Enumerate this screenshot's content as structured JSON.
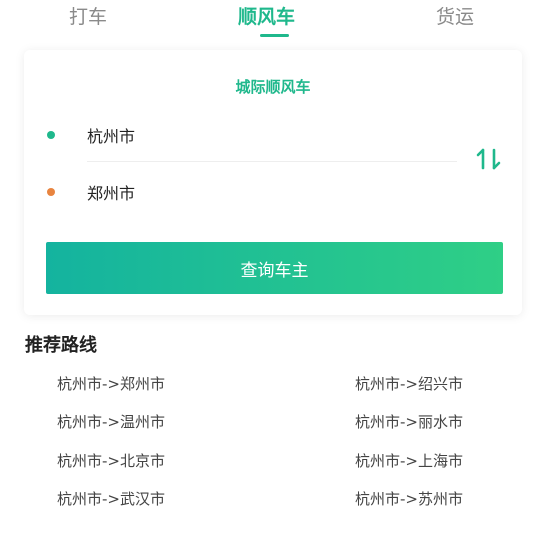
{
  "tabs": [
    {
      "label": "打车"
    },
    {
      "label": "顺风车"
    },
    {
      "label": "货运"
    }
  ],
  "card": {
    "title": "城际顺风车",
    "from_city": "杭州市",
    "to_city": "郑州市",
    "query_button": "查询车主"
  },
  "recommend": {
    "title": "推荐路线",
    "left": [
      "杭州市->郑州市",
      "杭州市->温州市",
      "杭州市->北京市",
      "杭州市->武汉市"
    ],
    "right": [
      "杭州市->绍兴市",
      "杭州市->丽水市",
      "杭州市->上海市",
      "杭州市->苏州市"
    ]
  },
  "colors": {
    "accent": "#1fb88c",
    "origin_dot": "#1fb88c",
    "destination_dot": "#e8843f"
  },
  "icons": {
    "swap": "swap-arrows-icon"
  }
}
